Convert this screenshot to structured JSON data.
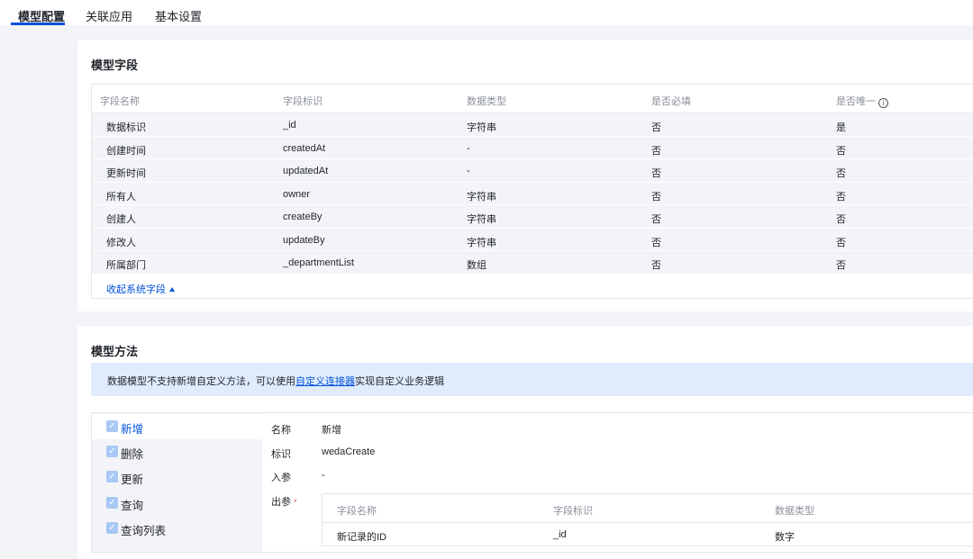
{
  "tabs": [
    {
      "label": "模型配置",
      "active": true
    },
    {
      "label": "关联应用",
      "active": false
    },
    {
      "label": "基本设置",
      "active": false
    }
  ],
  "fields_section": {
    "title": "模型字段",
    "columns": [
      "字段名称",
      "字段标识",
      "数据类型",
      "是否必填",
      "是否唯一"
    ],
    "rows": [
      [
        "数据标识",
        "_id",
        "字符串",
        "否",
        "是"
      ],
      [
        "创建时间",
        "createdAt",
        "-",
        "否",
        "否"
      ],
      [
        "更新时间",
        "updatedAt",
        "-",
        "否",
        "否"
      ],
      [
        "所有人",
        "owner",
        "字符串",
        "否",
        "否"
      ],
      [
        "创建人",
        "createBy",
        "字符串",
        "否",
        "否"
      ],
      [
        "修改人",
        "updateBy",
        "字符串",
        "否",
        "否"
      ],
      [
        "所属部门",
        "_departmentList",
        "数组",
        "否",
        "否"
      ]
    ],
    "collapse_label": "收起系统字段"
  },
  "methods_section": {
    "title": "模型方法",
    "notice_prefix": "数据模型不支持新增自定义方法，可以使用",
    "notice_link": "自定义连接器",
    "notice_suffix": "实现自定义业务逻辑",
    "methods": [
      {
        "label": "新增",
        "active": true
      },
      {
        "label": "删除",
        "active": false
      },
      {
        "label": "更新",
        "active": false
      },
      {
        "label": "查询",
        "active": false
      },
      {
        "label": "查询列表",
        "active": false
      }
    ],
    "detail": {
      "name_label": "名称",
      "name_value": "新增",
      "id_label": "标识",
      "id_value": "wedaCreate",
      "input_label": "入参",
      "input_value": "-",
      "output_label": "出参",
      "output_required_mark": "*",
      "output_columns": [
        "字段名称",
        "字段标识",
        "数据类型"
      ],
      "output_rows": [
        [
          "新记录的ID",
          "_id",
          "数字"
        ]
      ]
    }
  },
  "colors": {
    "accent": "#0052d9",
    "notice_bg": "#e0ecfd",
    "required": "#e34d59"
  }
}
